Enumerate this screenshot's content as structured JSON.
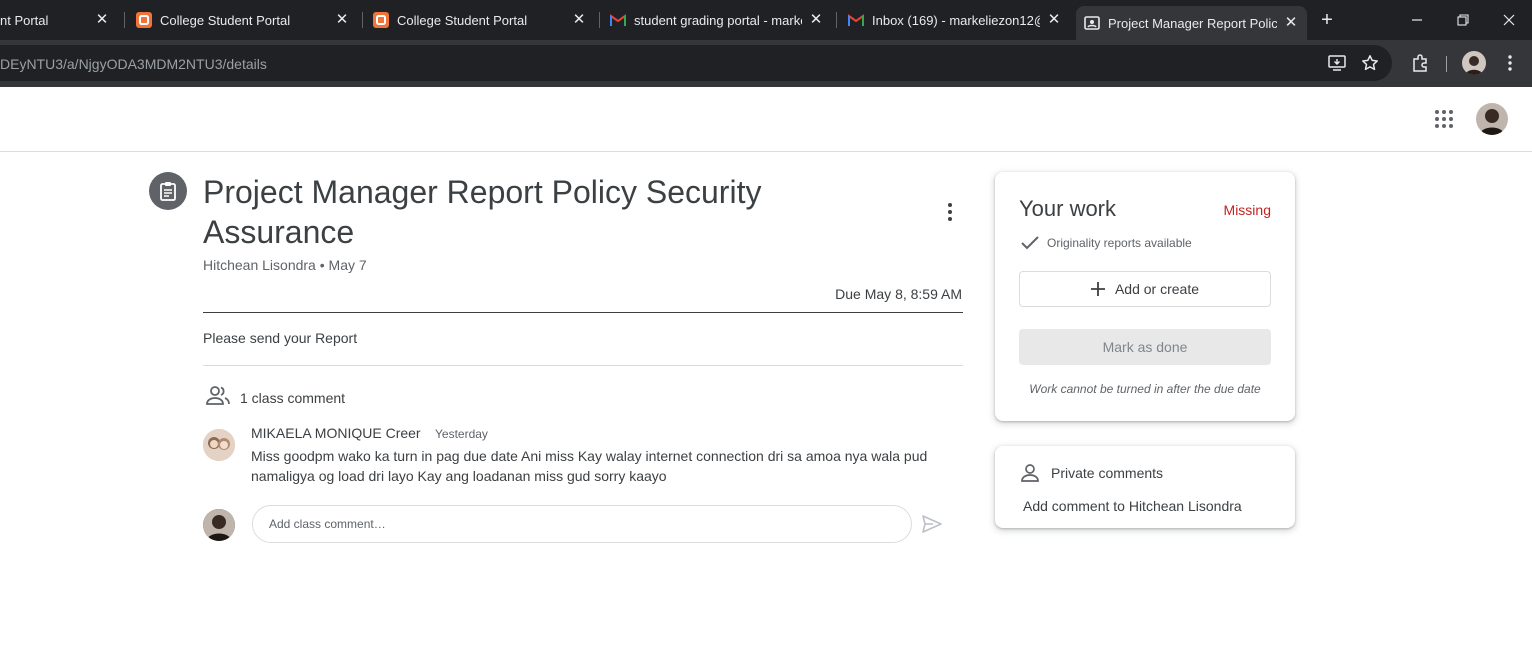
{
  "browser": {
    "tabs": [
      {
        "title": "nt Portal",
        "icon": "college-portal-icon",
        "active": false
      },
      {
        "title": "College Student Portal",
        "icon": "college-portal-icon",
        "active": false
      },
      {
        "title": "College Student Portal",
        "icon": "college-portal-icon",
        "active": false
      },
      {
        "title": "student grading portal - markel",
        "icon": "gmail-icon",
        "active": false
      },
      {
        "title": "Inbox (169) - markeliezon12@g",
        "icon": "gmail-icon",
        "active": false
      },
      {
        "title": "Project Manager Report Policy S",
        "icon": "classroom-icon",
        "active": true
      }
    ],
    "url": "DEyNTU3/a/NjgyODA3MDM2NTU3/details"
  },
  "assignment": {
    "title": "Project Manager Report Policy Security Assurance",
    "author": "Hitchean Lisondra",
    "posted": "May 7",
    "meta": "Hitchean Lisondra • May 7",
    "due": "Due May 8, 8:59 AM",
    "instructions": "Please send your Report"
  },
  "class_comments": {
    "count_label": "1 class comment",
    "items": [
      {
        "author": "MIKAELA MONIQUE Creer",
        "date": "Yesterday",
        "text": "Miss goodpm wako ka turn in pag due date Ani miss Kay walay internet connection dri sa amoa nya wala pud namaligya og load dri layo Kay ang loadanan miss gud sorry kaayo"
      }
    ],
    "input_placeholder": "Add class comment…"
  },
  "your_work": {
    "title": "Your work",
    "status": "Missing",
    "status_color": "#c5221f",
    "originality": "Originality reports available",
    "add_label": "Add or create",
    "done_label": "Mark as done",
    "late_note": "Work cannot be turned in after the due date"
  },
  "private_comments": {
    "title": "Private comments",
    "add_label": "Add comment to Hitchean Lisondra"
  }
}
